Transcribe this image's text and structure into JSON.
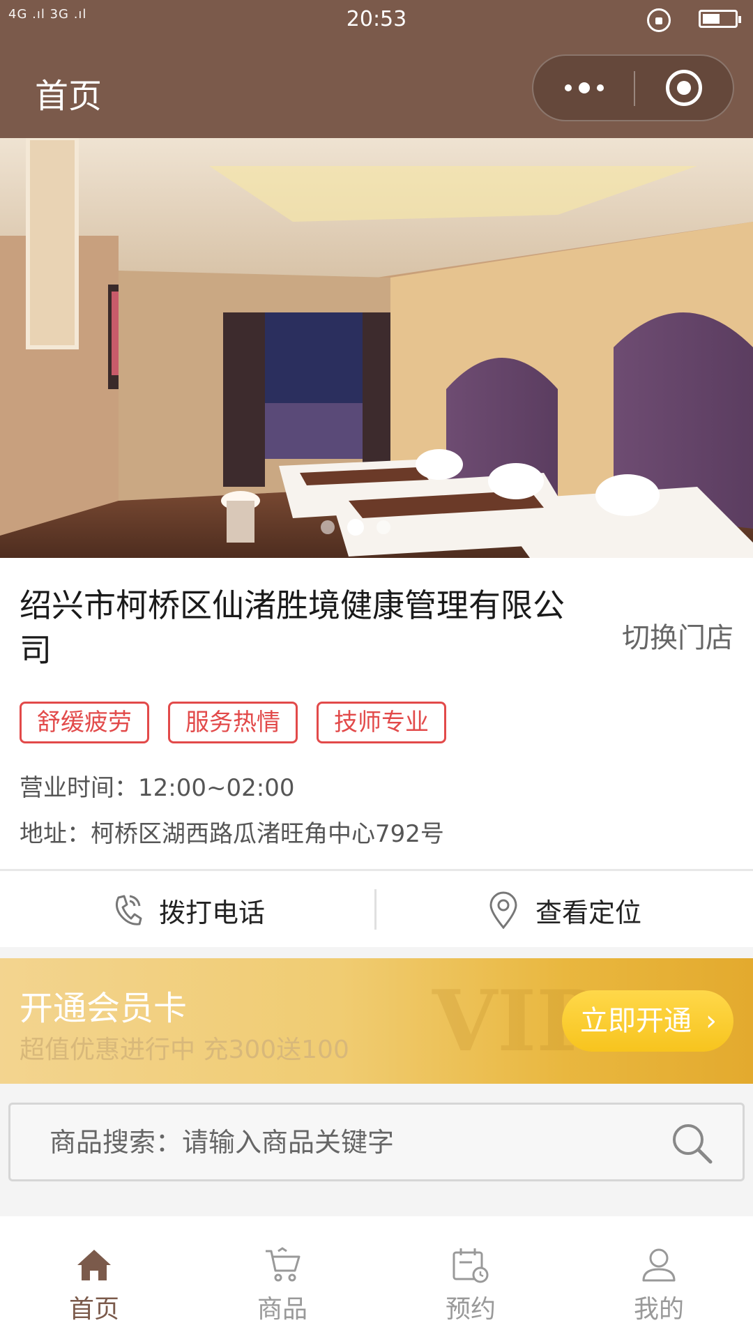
{
  "status_bar": {
    "signal": "4G .ıl 3G .ıl",
    "time": "20:53"
  },
  "nav": {
    "title": "首页"
  },
  "banner": {
    "slide_count": 3,
    "active_slide": 2
  },
  "store": {
    "name": "绍兴市柯桥区仙渚胜境健康管理有限公司",
    "switch_label": "切换门店",
    "tags": [
      "舒缓疲劳",
      "服务热情",
      "技师专业"
    ],
    "hours": "营业时间：12:00~02:00",
    "address": "地址：柯桥区湖西路瓜渚旺角中心792号"
  },
  "actions": {
    "call_label": "拨打电话",
    "location_label": "查看定位"
  },
  "vip": {
    "title": "开通会员卡",
    "subtitle": "超值优惠进行中 充300送100",
    "button_label": "立即开通",
    "button_chevron": "›",
    "watermark": "VIP"
  },
  "search": {
    "placeholder": "商品搜索：请输入商品关键字"
  },
  "tabbar": {
    "items": [
      {
        "label": "首页",
        "icon": "home-icon",
        "active": true
      },
      {
        "label": "商品",
        "icon": "cart-icon",
        "active": false
      },
      {
        "label": "预约",
        "icon": "calendar-icon",
        "active": false
      },
      {
        "label": "我的",
        "icon": "user-icon",
        "active": false
      }
    ]
  },
  "colors": {
    "brand": "#7b5a4b",
    "tag_red": "#e24a4a",
    "vip_gold": "#f0cc72",
    "button_yellow": "#f7c41e"
  }
}
